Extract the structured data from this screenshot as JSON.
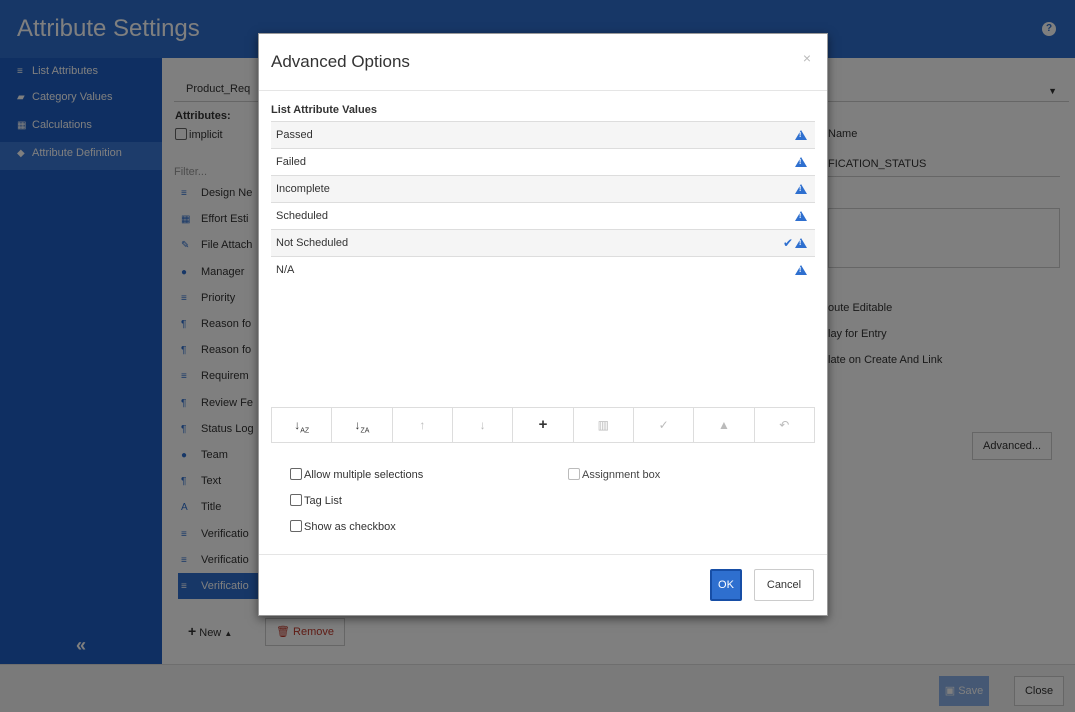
{
  "app": {
    "title": "Attribute Settings",
    "help_icon": "question-circle-icon"
  },
  "sidebar": {
    "items": [
      {
        "label": "List Attributes",
        "icon": "list-icon"
      },
      {
        "label": "Category Values",
        "icon": "folder-icon"
      },
      {
        "label": "Calculations",
        "icon": "calculator-icon"
      },
      {
        "label": "Attribute Definition",
        "icon": "tag-icon"
      }
    ],
    "collapse_glyph": "«"
  },
  "main": {
    "item_type_value": "Product_Req",
    "attributes_label": "Attributes:",
    "implicit_label": "implicit",
    "filter_placeholder": "Filter...",
    "attribute_list": [
      {
        "label": "Design Ne",
        "icon": "list-icon"
      },
      {
        "label": "Effort Esti",
        "icon": "calculator-icon"
      },
      {
        "label": "File Attach",
        "icon": "paperclip-icon"
      },
      {
        "label": "Manager",
        "icon": "user-icon"
      },
      {
        "label": "Priority",
        "icon": "list-icon"
      },
      {
        "label": "Reason fo",
        "icon": "paragraph-icon"
      },
      {
        "label": "Reason fo",
        "icon": "paragraph-icon"
      },
      {
        "label": "Requirem",
        "icon": "list-icon"
      },
      {
        "label": "Review Fe",
        "icon": "paragraph-icon"
      },
      {
        "label": "Status Log",
        "icon": "paragraph-icon"
      },
      {
        "label": "Team",
        "icon": "user-icon"
      },
      {
        "label": "Text",
        "icon": "paragraph-icon"
      },
      {
        "label": "Title",
        "icon": "text-icon"
      },
      {
        "label": "Verificatio",
        "icon": "list-icon"
      },
      {
        "label": "Verificatio",
        "icon": "list-icon"
      },
      {
        "label": "Verificatio",
        "icon": "list-icon"
      }
    ],
    "new_button": "New",
    "remove_button": "Remove",
    "right": {
      "name_label": "Name",
      "name_value": "FICATION_STATUS",
      "editable_label": "oute Editable",
      "display_label": "lay for Entry",
      "create_label": "late on Create And Link",
      "advanced_button": "Advanced..."
    }
  },
  "footer": {
    "save_label": "Save",
    "close_label": "Close"
  },
  "modal": {
    "title": "Advanced Options",
    "close_glyph": "×",
    "section_label": "List Attribute Values",
    "values": [
      {
        "label": "Passed",
        "checked": false
      },
      {
        "label": "Failed",
        "checked": false
      },
      {
        "label": "Incomplete",
        "checked": false
      },
      {
        "label": "Scheduled",
        "checked": false
      },
      {
        "label": "Not Scheduled",
        "checked": true
      },
      {
        "label": "N/A",
        "checked": false
      }
    ],
    "toolbar": {
      "sort_asc": "↓A̲Z",
      "sort_desc": "↓Z̲A",
      "move_up": "🡑",
      "move_down": "🡓",
      "add": "+",
      "delete": "🗑",
      "check": "✓",
      "warn": "⚠",
      "undo": "↶"
    },
    "options": {
      "allow_multiple": "Allow multiple selections",
      "tag_list": "Tag List",
      "show_checkbox": "Show as checkbox",
      "assignment_box": "Assignment box"
    },
    "ok_label": "OK",
    "cancel_label": "Cancel"
  },
  "colors": {
    "brand": "#2e6fcf",
    "sidebar": "#1e5fc4",
    "overlay": "rgba(0,0,0,0.5)"
  }
}
